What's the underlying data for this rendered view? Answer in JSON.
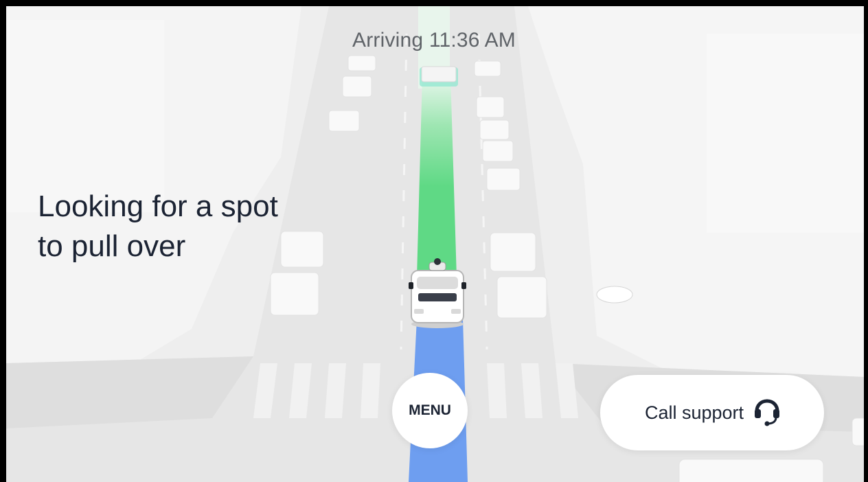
{
  "header": {
    "arrival_text": "Arriving 11:36 AM"
  },
  "status": {
    "line1": "Looking for a spot",
    "line2": "to pull over"
  },
  "controls": {
    "menu_label": "MENU",
    "support_label": "Call support",
    "support_icon": "headset-icon"
  },
  "map": {
    "route_ahead_color": "#5fd985",
    "route_traveled_color": "#6e9ef0",
    "destination_marker_color": "#8fe7d0"
  }
}
